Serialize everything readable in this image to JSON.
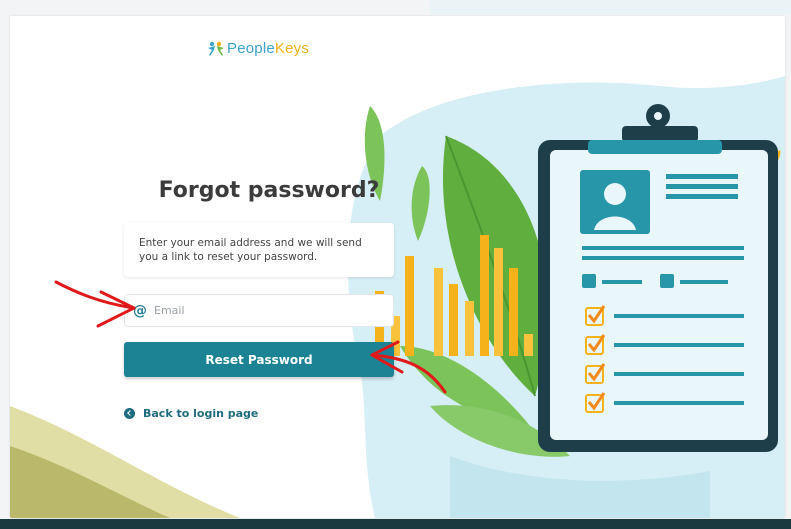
{
  "logo": {
    "brand_primary": "People",
    "brand_secondary": "Keys"
  },
  "form": {
    "title": "Forgot password?",
    "instructions": "Enter your email address and we will send you a link to reset your password.",
    "email_placeholder": "Email",
    "email_value": "",
    "email_icon": "@",
    "submit_label": "Reset Password",
    "back_link_label": "Back to login page"
  },
  "colors": {
    "primary": "#1c8394",
    "link": "#1f6c80",
    "annotation": "#e01a1a",
    "bar": "#f6b21b",
    "leaf": "#6cbc4a"
  },
  "icons": {
    "logo": "people-logo-icon",
    "email": "at-sign-icon",
    "back": "chevron-left-circle-icon"
  }
}
